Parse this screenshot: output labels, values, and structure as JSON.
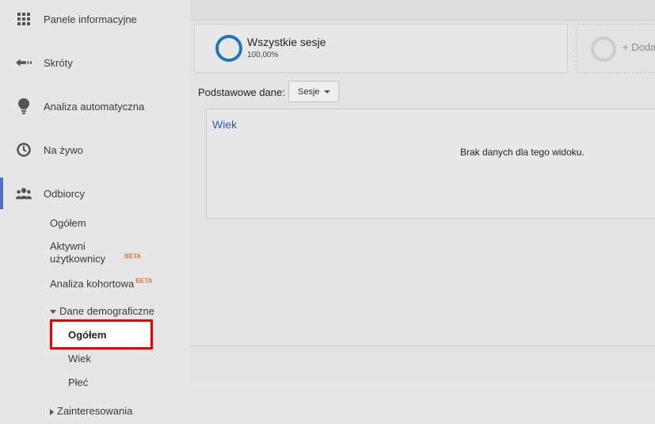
{
  "sidebar": {
    "items": [
      {
        "label": "Panele informacyjne",
        "icon": "dashboard-grid-icon"
      },
      {
        "label": "Skróty",
        "icon": "shortcut-arrow-icon"
      },
      {
        "label": "Analiza automatyczna",
        "icon": "lightbulb-icon"
      },
      {
        "label": "Na żywo",
        "icon": "clock-icon"
      },
      {
        "label": "Odbiorcy",
        "icon": "people-icon"
      }
    ],
    "audience_sub": {
      "overview": "Ogółem",
      "active_users": "Aktywni użytkownicy",
      "cohort": "Analiza kohortowa",
      "beta": "BETA",
      "demographics": "Dane demograficzne",
      "demographics_children": [
        "Ogółem",
        "Wiek",
        "Płeć"
      ],
      "interests": "Zainteresowania"
    },
    "accent_color": "#4a74bd"
  },
  "main": {
    "segment": {
      "title": "Wszystkie sesje",
      "value": "100,00%",
      "color": "#1f79b6"
    },
    "add_segment": "+ Doda",
    "dimension": {
      "label": "Podstawowe dane:",
      "selected": "Sesje"
    },
    "panel": {
      "title": "Wiek",
      "empty_message": "Brak danych dla tego widoku."
    }
  }
}
